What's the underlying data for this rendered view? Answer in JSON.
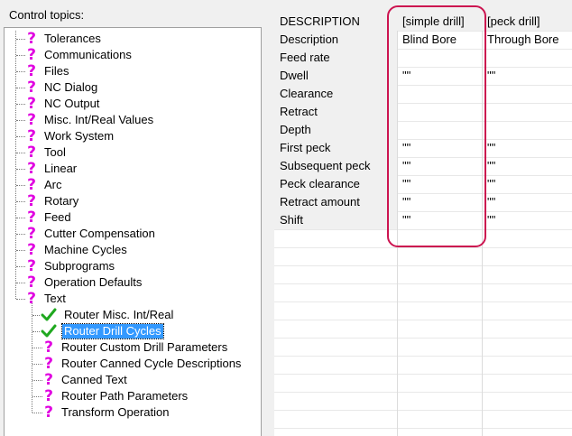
{
  "panel_label": "Control topics:",
  "tree": {
    "items": [
      {
        "label": "Tolerances",
        "icon": "question"
      },
      {
        "label": "Communications",
        "icon": "question"
      },
      {
        "label": "Files",
        "icon": "question"
      },
      {
        "label": "NC Dialog",
        "icon": "question"
      },
      {
        "label": "NC Output",
        "icon": "question"
      },
      {
        "label": "Misc. Int/Real Values",
        "icon": "question"
      },
      {
        "label": "Work System",
        "icon": "question"
      },
      {
        "label": "Tool",
        "icon": "question"
      },
      {
        "label": "Linear",
        "icon": "question"
      },
      {
        "label": "Arc",
        "icon": "question"
      },
      {
        "label": "Rotary",
        "icon": "question"
      },
      {
        "label": "Feed",
        "icon": "question"
      },
      {
        "label": "Cutter Compensation",
        "icon": "question"
      },
      {
        "label": "Machine Cycles",
        "icon": "question"
      },
      {
        "label": "Subprograms",
        "icon": "question"
      },
      {
        "label": "Operation Defaults",
        "icon": "question"
      },
      {
        "label": "Text",
        "icon": "question"
      }
    ],
    "children": [
      {
        "label": "Router Misc. Int/Real",
        "icon": "check"
      },
      {
        "label": "Router Drill Cycles",
        "icon": "check",
        "selected": true
      },
      {
        "label": "Router Custom Drill Parameters",
        "icon": "question"
      },
      {
        "label": "Router Canned Cycle Descriptions",
        "icon": "question"
      },
      {
        "label": "Canned Text",
        "icon": "question"
      },
      {
        "label": "Router Path Parameters",
        "icon": "question"
      },
      {
        "label": "Transform Operation",
        "icon": "question"
      }
    ]
  },
  "grid": {
    "headers": [
      "DESCRIPTION",
      "[simple drill]",
      "[peck drill]"
    ],
    "rows": [
      [
        "Description",
        "Blind Bore",
        "Through Bore"
      ],
      [
        "Feed rate",
        "",
        ""
      ],
      [
        "Dwell",
        "\"\"",
        "\"\""
      ],
      [
        "Clearance",
        "",
        ""
      ],
      [
        "Retract",
        "",
        ""
      ],
      [
        "Depth",
        "",
        ""
      ],
      [
        "First peck",
        "\"\"",
        "\"\""
      ],
      [
        "Subsequent peck",
        "\"\"",
        "\"\""
      ],
      [
        "Peck clearance",
        "\"\"",
        "\"\""
      ],
      [
        "Retract amount",
        "\"\"",
        "\"\""
      ],
      [
        "Shift",
        "\"\"",
        "\"\""
      ]
    ]
  },
  "colors": {
    "question_icon": "#e000e0",
    "check_icon": "#1fa81f",
    "selection": "#3399ff",
    "highlight_box": "#cc1450"
  }
}
